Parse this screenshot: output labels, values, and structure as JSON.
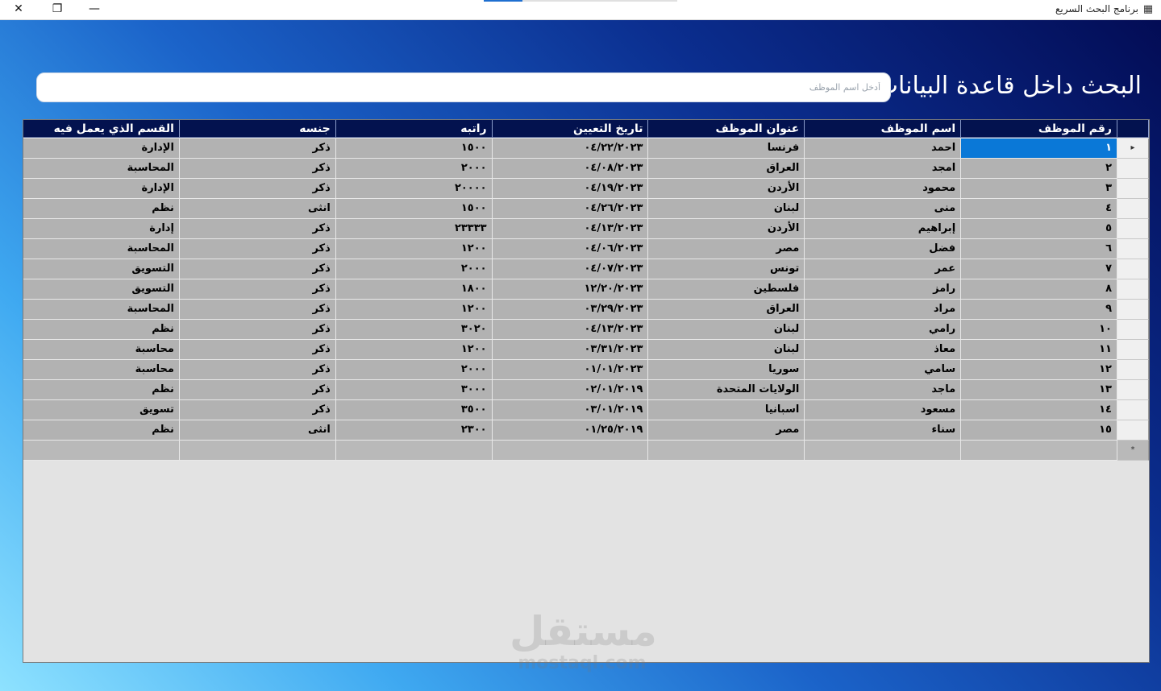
{
  "window": {
    "title": "برنامج  البحث السريع",
    "minimize": "—",
    "maximize": "❐",
    "close": "✕"
  },
  "heading": "البحث داخل قاعدة البيانات",
  "search": {
    "placeholder": "أدخل اسم الموظف",
    "value": ""
  },
  "table": {
    "columns": [
      "رقم الموظف",
      "اسم الموظف",
      "عنوان الموظف",
      "تاريخ التعيين",
      "راتبه",
      "جنسه",
      "القسم الذي يعمل فيه"
    ],
    "current_row_marker": "▸",
    "new_row_marker": "*",
    "rows": [
      [
        "١",
        "احمد",
        "فرنسا",
        "٠٤/٢٢/٢٠٢٣",
        "١٥٠٠",
        "ذكر",
        "الإدارة"
      ],
      [
        "٢",
        "امجد",
        "العراق",
        "٠٤/٠٨/٢٠٢٣",
        "٢٠٠٠",
        "ذكر",
        "المحاسبة"
      ],
      [
        "٣",
        "محمود",
        "الأردن",
        "٠٤/١٩/٢٠٢٣",
        "٢٠٠٠٠",
        "ذكر",
        "الإدارة"
      ],
      [
        "٤",
        "منى",
        "لبنان",
        "٠٤/٢٦/٢٠٢٣",
        "١٥٠٠",
        "انثى",
        "نظم"
      ],
      [
        "٥",
        "إبراهيم",
        "الأردن",
        "٠٤/١٣/٢٠٢٣",
        "٢٣٣٣٣",
        "ذكر",
        "إدارة"
      ],
      [
        "٦",
        "فضل",
        "مصر",
        "٠٤/٠٦/٢٠٢٣",
        "١٢٠٠",
        "ذكر",
        "المحاسبة"
      ],
      [
        "٧",
        "عمر",
        "تونس",
        "٠٤/٠٧/٢٠٢٣",
        "٢٠٠٠",
        "ذكر",
        "التسويق"
      ],
      [
        "٨",
        "رامز",
        "فلسطين",
        "١٢/٢٠/٢٠٢٣",
        "١٨٠٠",
        "ذكر",
        "التسويق"
      ],
      [
        "٩",
        "مراد",
        "العراق",
        "٠٣/٢٩/٢٠٢٣",
        "١٢٠٠",
        "ذكر",
        "المحاسبة"
      ],
      [
        "١٠",
        "رامي",
        "لبنان",
        "٠٤/١٣/٢٠٢٣",
        "٣٠٢٠",
        "ذكر",
        "نظم"
      ],
      [
        "١١",
        "معاذ",
        "لبنان",
        "٠٣/٣١/٢٠٢٣",
        "١٢٠٠",
        "ذكر",
        "محاسبة"
      ],
      [
        "١٢",
        "سامي",
        "سوريا",
        "٠١/٠١/٢٠٢٣",
        "٢٠٠٠",
        "ذكر",
        "محاسبة"
      ],
      [
        "١٣",
        "ماجد",
        "الولايات المتحدة",
        "٠٢/٠١/٢٠١٩",
        "٣٠٠٠",
        "ذكر",
        "نظم"
      ],
      [
        "١٤",
        "مسعود",
        "اسبانيا",
        "٠٣/٠١/٢٠١٩",
        "٣٥٠٠",
        "ذكر",
        "تسويق"
      ],
      [
        "١٥",
        "سناء",
        "مصر",
        "٠١/٢٥/٢٠١٩",
        "٢٣٠٠",
        "انثى",
        "نظم"
      ]
    ]
  },
  "watermark": {
    "arabic": "مستقل",
    "latin": "mostaql.com"
  }
}
